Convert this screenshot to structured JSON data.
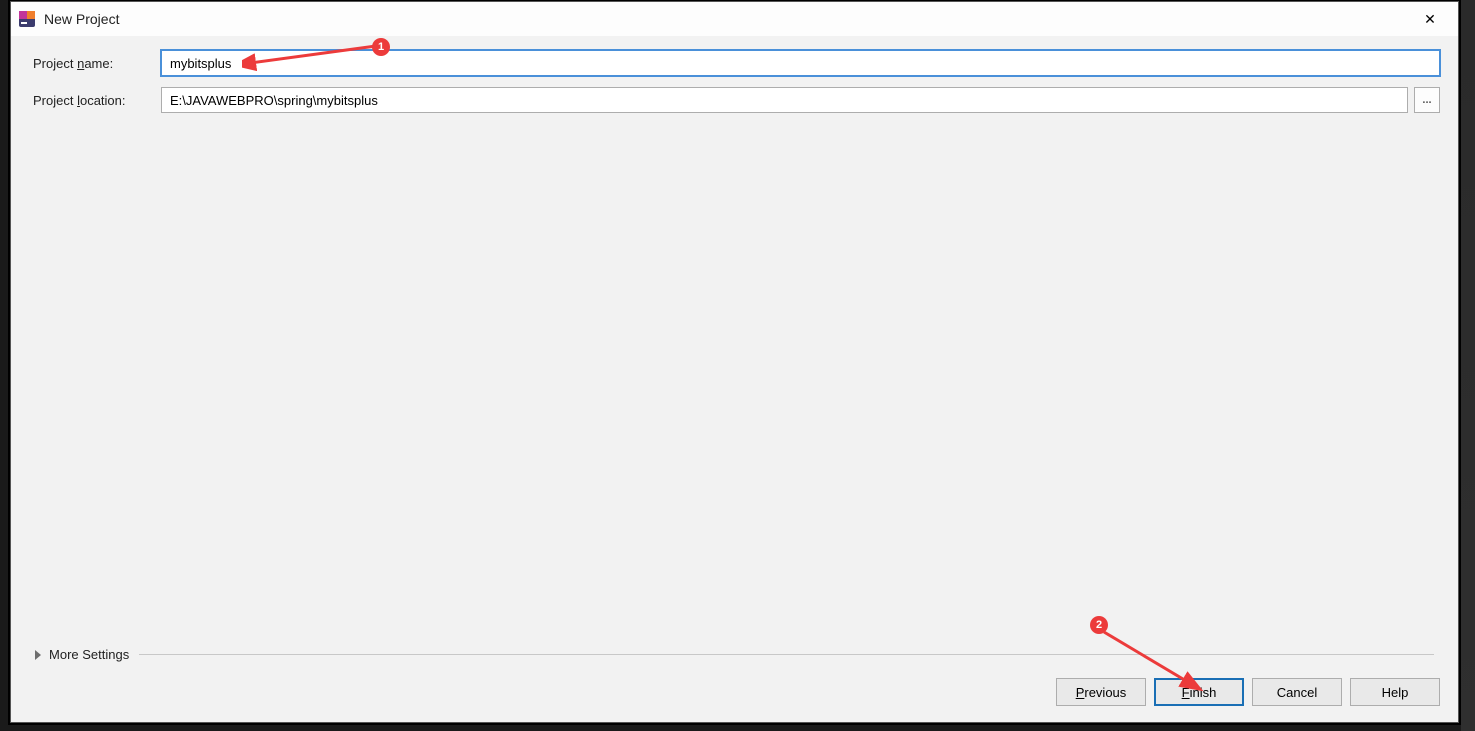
{
  "dialog": {
    "title": "New Project",
    "close_glyph": "✕"
  },
  "form": {
    "project_name_label_pre": "Project ",
    "project_name_label_u": "n",
    "project_name_label_post": "ame:",
    "project_name_value": "mybitsplus",
    "project_location_label_pre": "Project ",
    "project_location_label_u": "l",
    "project_location_label_post": "ocation:",
    "project_location_value": "E:\\JAVAWEBPRO\\spring\\mybitsplus",
    "browse_label": "..."
  },
  "more": {
    "label_u": "M",
    "label_post": "ore Settings"
  },
  "buttons": {
    "previous_u": "P",
    "previous_post": "revious",
    "finish_u": "F",
    "finish_post": "inish",
    "cancel": "Cancel",
    "help": "Help"
  },
  "annotations": {
    "badge1": "1",
    "badge2": "2"
  }
}
